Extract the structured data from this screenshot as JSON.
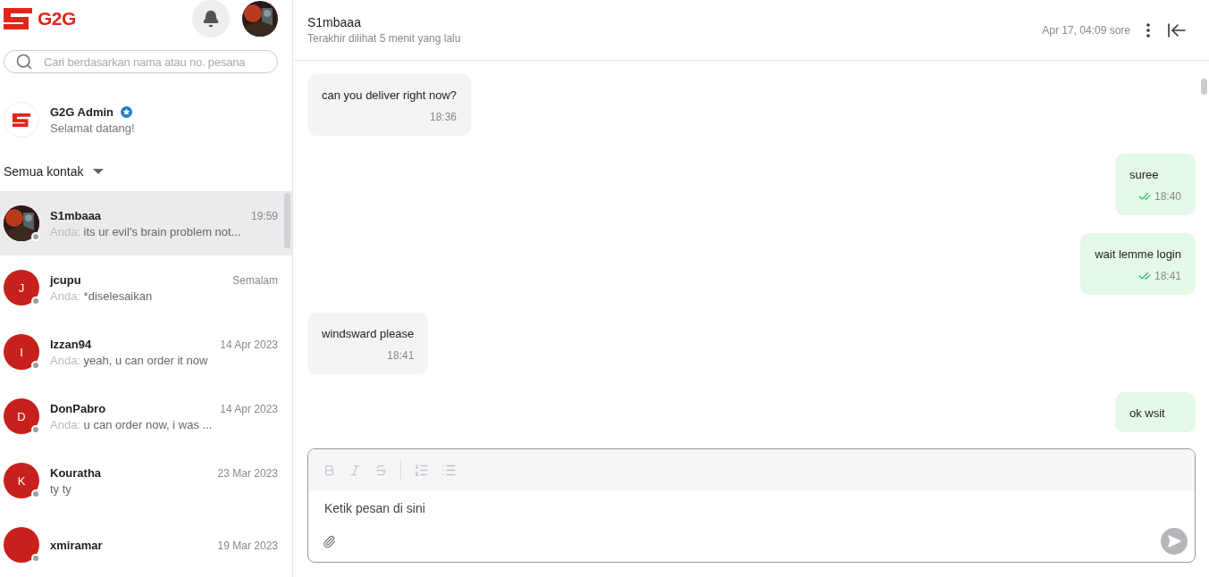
{
  "sidebar": {
    "logo": "G2G",
    "search": {
      "placeholder": "Cari berdasarkan nama atau no. pesana"
    },
    "pinned": {
      "name": "G2G Admin",
      "verified": true,
      "preview": "Selamat datang!"
    },
    "filter": "Semua kontak",
    "contacts": [
      {
        "name": "S1mbaaa",
        "time": "19:59",
        "prefix": "Anda:",
        "preview": "its ur evil's brain problem not...",
        "selected": true
      },
      {
        "name": "jcupu",
        "time": "Semalam",
        "prefix": "Anda:",
        "preview": "*diselesaikan",
        "avatar": {
          "kind": "initial",
          "initial": "J"
        },
        "selected": false
      },
      {
        "name": "Izzan94",
        "time": "14 Apr 2023",
        "prefix": "Anda:",
        "preview": "yeah, u can order it now",
        "avatar": {
          "kind": "initial",
          "initial": "I"
        },
        "selected": false
      },
      {
        "name": "DonPabro",
        "time": "14 Apr 2023",
        "prefix": "Anda:",
        "preview": "u can order now, i was ...",
        "avatar": {
          "kind": "initial",
          "initial": "D"
        },
        "selected": false
      },
      {
        "name": "Kouratha",
        "time": "23 Mar 2023",
        "preview": "ty ty",
        "avatar": {
          "kind": "initial",
          "initial": "K"
        },
        "selected": false
      },
      {
        "name": "xmiramar",
        "time": "19 Mar 2023",
        "avatar": {
          "kind": "initial"
        },
        "selected": false
      }
    ]
  },
  "chat": {
    "name": "S1mbaaa",
    "status": "Terakhir dilihat 5 menit yang lalu",
    "date": "Apr 17, 04:09 sore",
    "messages": [
      {
        "kind": "in",
        "text": "can you deliver right now?",
        "time": "18:36"
      },
      {
        "kind": "out",
        "text": "suree",
        "time": "18:40",
        "read": true
      },
      {
        "kind": "out",
        "text": "wait lemme login",
        "time": "18:41",
        "read": true
      },
      {
        "kind": "in",
        "text": "windsward please",
        "time": "18:41"
      },
      {
        "kind": "out",
        "text": "ok wsit"
      }
    ],
    "composer": {
      "placeholder": "Ketik pesan di sini"
    }
  }
}
